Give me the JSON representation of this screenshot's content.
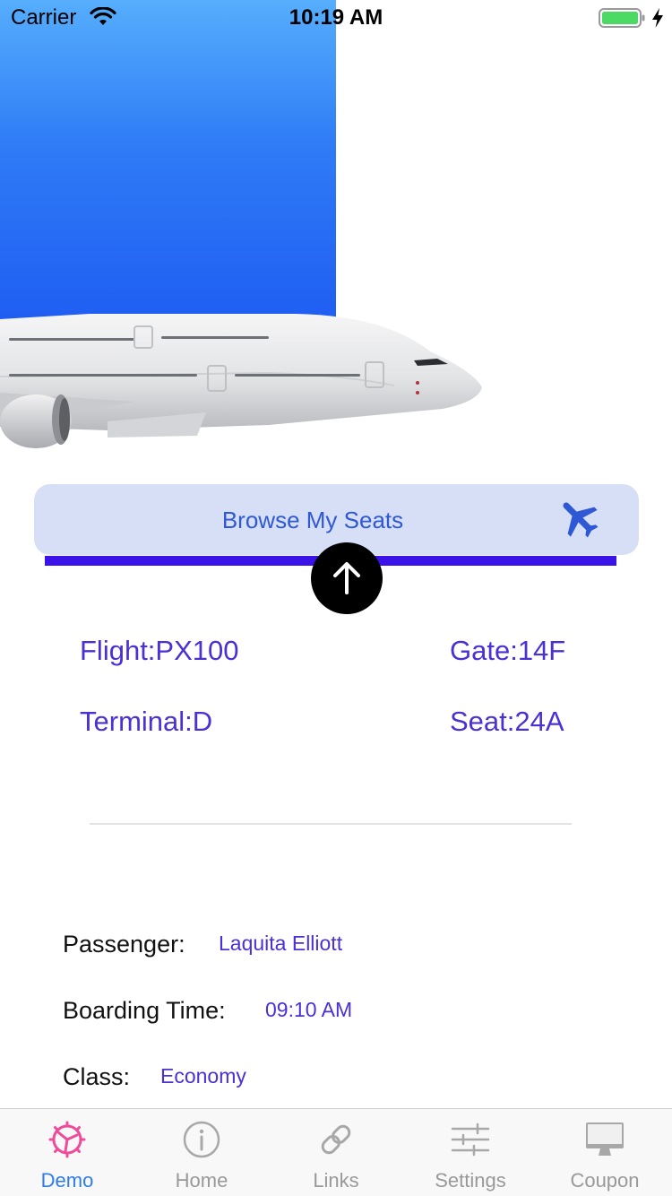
{
  "status_bar": {
    "carrier": "Carrier",
    "time": "10:19 AM"
  },
  "main": {
    "browse_button_label": "Browse My Seats",
    "flight": "Flight:PX100",
    "gate": "Gate:14F",
    "terminal": "Terminal:D",
    "seat": "Seat:24A"
  },
  "details": {
    "passenger_label": "Passenger:",
    "passenger_value": "Laquita Elliott",
    "boarding_label": "Boarding Time:",
    "boarding_value": "09:10 AM",
    "class_label": "Class:",
    "class_value": "Economy"
  },
  "tab_bar": {
    "items": [
      {
        "label": "Demo",
        "icon": "demo-icon",
        "active": true
      },
      {
        "label": "Home",
        "icon": "info-icon",
        "active": false
      },
      {
        "label": "Links",
        "icon": "link-icon",
        "active": false
      },
      {
        "label": "Settings",
        "icon": "sliders-icon",
        "active": false
      },
      {
        "label": "Coupon",
        "icon": "monitor-icon",
        "active": false
      }
    ]
  },
  "colors": {
    "accent": "#4b30d4",
    "progress": "#3b12e8",
    "button_bg": "#d6dff6",
    "tab_active": "#2f7ce8",
    "demo_icon": "#ef4b9a"
  }
}
